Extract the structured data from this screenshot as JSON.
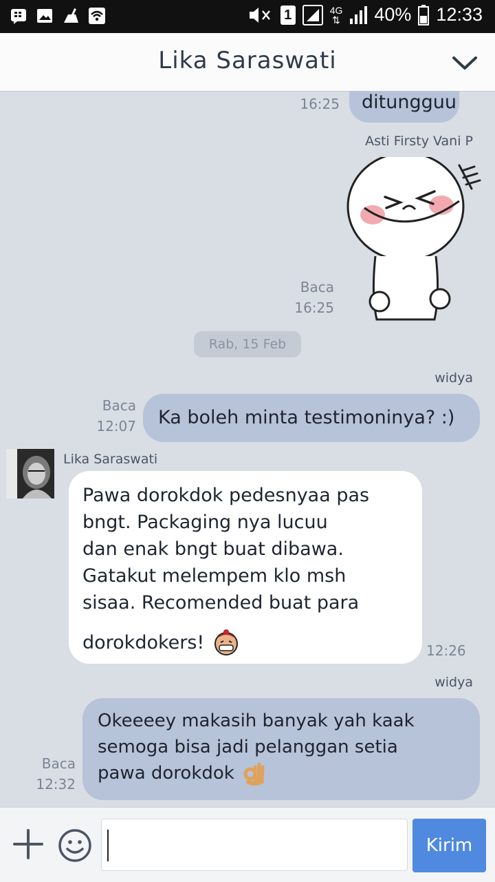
{
  "status_bar": {
    "network": "4G",
    "sim": "1",
    "battery": "40%",
    "time": "12:33"
  },
  "header": {
    "title": "Lika Saraswati"
  },
  "messages": {
    "m1": {
      "text": "ditungguu",
      "status": "Baca",
      "time": "16:25"
    },
    "m2": {
      "sender": "Asti Firsty Vani P",
      "status": "Baca",
      "time": "16:25"
    },
    "date_separator": "Rab, 15 Feb",
    "m3": {
      "sender": "widya",
      "text": "Ka boleh minta testimoninya? :)",
      "status": "Baca",
      "time": "12:07"
    },
    "m4": {
      "sender": "Lika Saraswati",
      "lines": [
        "Pawa dorokdok pedesnyaa pas",
        "bngt. Packaging nya lucuu",
        "dan enak bngt buat dibawa.",
        "Gatakut melempem klo msh",
        "sisaa. Recomended buat para",
        "dorokdokers!"
      ],
      "time": "12:26"
    },
    "m5": {
      "sender": "widya",
      "lines": [
        "Okeeeey makasih banyak yah kaak",
        "semoga bisa jadi pelanggan setia",
        "pawa dorokdok"
      ],
      "status": "Baca",
      "time": "12:32"
    }
  },
  "input": {
    "value": "",
    "send_label": "Kirim"
  },
  "colors": {
    "background": "#d9dde4",
    "outgoing_bubble": "#b6c3d8",
    "incoming_bubble": "#ffffff",
    "send_button": "#4f8ae0"
  }
}
